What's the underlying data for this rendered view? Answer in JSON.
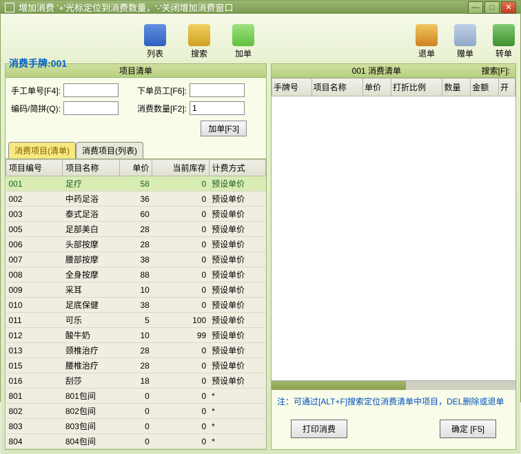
{
  "title": "增加消费    '+'光标定位到消费数量，'-'关闭增加消费窗口",
  "brand": "消费手牌:001",
  "toolbar": {
    "list": "列表",
    "search": "搜索",
    "add": "加单",
    "return": "退单",
    "give": "赠单",
    "transfer": "转单"
  },
  "left": {
    "header": "项目清单",
    "form": {
      "manual_label": "手工单号[F4]:",
      "manual_value": "",
      "emp_label": "下单员工[F6]:",
      "emp_value": "",
      "code_label": "编码/简拼(Q):",
      "code_value": "",
      "qty_label": "消费数量[F2]:",
      "qty_value": "1",
      "add_btn": "加单[F3]"
    },
    "tabs": {
      "t1": "消费项目(清单)",
      "t2": "消费项目(列表)"
    },
    "cols": {
      "c1": "项目编号",
      "c2": "项目名称",
      "c3": "单价",
      "c4": "当前库存",
      "c5": "计费方式"
    },
    "rows": [
      {
        "id": "001",
        "name": "足疗",
        "price": "58",
        "stock": "0",
        "mode": "预设单价",
        "sel": true
      },
      {
        "id": "002",
        "name": "中药足浴",
        "price": "36",
        "stock": "0",
        "mode": "预设单价"
      },
      {
        "id": "003",
        "name": "泰式足浴",
        "price": "60",
        "stock": "0",
        "mode": "预设单价"
      },
      {
        "id": "005",
        "name": "足部美白",
        "price": "28",
        "stock": "0",
        "mode": "预设单价"
      },
      {
        "id": "006",
        "name": "头部按摩",
        "price": "28",
        "stock": "0",
        "mode": "预设单价"
      },
      {
        "id": "007",
        "name": "腰部按摩",
        "price": "38",
        "stock": "0",
        "mode": "预设单价"
      },
      {
        "id": "008",
        "name": "全身按摩",
        "price": "88",
        "stock": "0",
        "mode": "预设单价"
      },
      {
        "id": "009",
        "name": "采耳",
        "price": "10",
        "stock": "0",
        "mode": "预设单价"
      },
      {
        "id": "010",
        "name": "足底保健",
        "price": "38",
        "stock": "0",
        "mode": "预设单价"
      },
      {
        "id": "011",
        "name": "可乐",
        "price": "5",
        "stock": "100",
        "mode": "预设单价"
      },
      {
        "id": "012",
        "name": "酸牛奶",
        "price": "10",
        "stock": "99",
        "mode": "预设单价"
      },
      {
        "id": "013",
        "name": "颈椎治疗",
        "price": "28",
        "stock": "0",
        "mode": "预设单价"
      },
      {
        "id": "015",
        "name": "腰椎治疗",
        "price": "28",
        "stock": "0",
        "mode": "预设单价"
      },
      {
        "id": "016",
        "name": "刮莎",
        "price": "18",
        "stock": "0",
        "mode": "预设单价"
      },
      {
        "id": "801",
        "name": "801包间",
        "price": "0",
        "stock": "0",
        "mode": "*"
      },
      {
        "id": "802",
        "name": "802包间",
        "price": "0",
        "stock": "0",
        "mode": "*"
      },
      {
        "id": "803",
        "name": "803包间",
        "price": "0",
        "stock": "0",
        "mode": "*"
      },
      {
        "id": "804",
        "name": "804包间",
        "price": "0",
        "stock": "0",
        "mode": "*"
      }
    ]
  },
  "right": {
    "header_title": "001 消费清单",
    "header_search": "搜索[F]:",
    "cols": {
      "c1": "手牌号",
      "c2": "项目名称",
      "c3": "单价",
      "c4": "打折比例",
      "c5": "数量",
      "c6": "金额",
      "c7": "开"
    },
    "note": "注：可通过[ALT+F]搜索定位消费清单中项目，DEL删除或退单",
    "print_btn": "打印消费",
    "ok_btn": "确定 [F5]"
  }
}
